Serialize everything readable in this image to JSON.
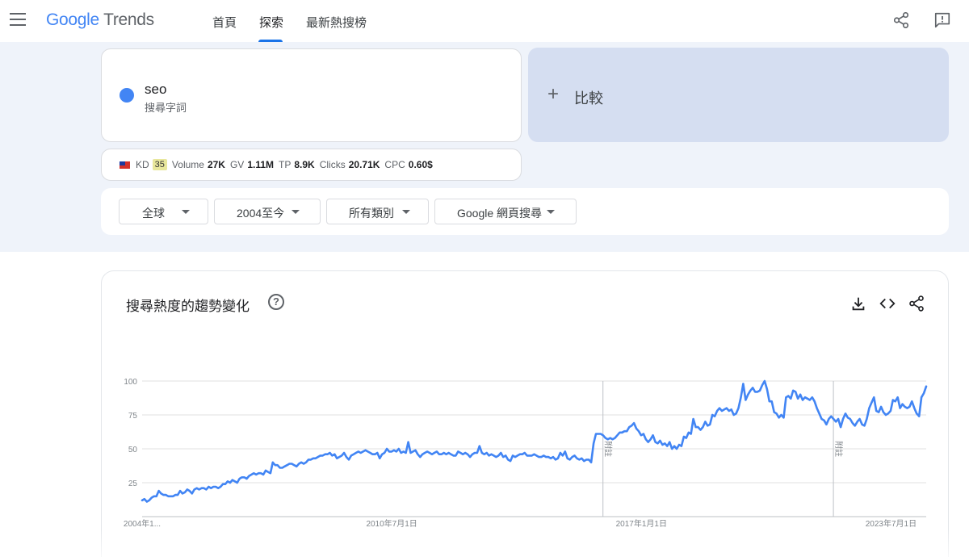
{
  "header": {
    "logo_google": "Google",
    "logo_product": "Trends",
    "tabs": [
      {
        "label": "首頁"
      },
      {
        "label": "探索"
      },
      {
        "label": "最新熱搜榜"
      }
    ],
    "active_tab": "探索"
  },
  "search_term": {
    "name": "seo",
    "type": "搜尋字詞",
    "color": "#4285f4"
  },
  "compare": {
    "label": "比較"
  },
  "metrics": {
    "kd_label": "KD",
    "kd_value": "35",
    "volume_label": "Volume",
    "volume_value": "27K",
    "gv_label": "GV",
    "gv_value": "1.11M",
    "tp_label": "TP",
    "tp_value": "8.9K",
    "clicks_label": "Clicks",
    "clicks_value": "20.71K",
    "cpc_label": "CPC",
    "cpc_value": "0.60$"
  },
  "filters": {
    "region": "全球",
    "time_range": "2004至今",
    "category": "所有類別",
    "search_type": "Google 網頁搜尋"
  },
  "chart_section": {
    "title": "搜尋熱度的趨勢變化",
    "help": "?"
  },
  "chart_data": {
    "type": "line",
    "series": [
      {
        "color": "#4285f4",
        "values": [
          12,
          13,
          11,
          12,
          14,
          15,
          15,
          19,
          17,
          16,
          16,
          15,
          15,
          15,
          16,
          16,
          19,
          17,
          18,
          20,
          19,
          17,
          20,
          21,
          20,
          21,
          21,
          20,
          22,
          21,
          22,
          22,
          21,
          22,
          24,
          24,
          26,
          25,
          27,
          26,
          25,
          28,
          29,
          29,
          28,
          30,
          31,
          32,
          31,
          32,
          32,
          31,
          34,
          33,
          32,
          40,
          38,
          38,
          36,
          36,
          37,
          38,
          39,
          39,
          38,
          37,
          39,
          40,
          39,
          40,
          42,
          42,
          43,
          43,
          44,
          45,
          45,
          46,
          46,
          47,
          45,
          46,
          43,
          44,
          45,
          47,
          44,
          42,
          45,
          46,
          47,
          48,
          47,
          48,
          49,
          48,
          47,
          46,
          46,
          47,
          43,
          46,
          47,
          50,
          48,
          48,
          49,
          48,
          50,
          47,
          48,
          47,
          55,
          47,
          48,
          49,
          46,
          44,
          46,
          47,
          48,
          47,
          46,
          47,
          48,
          46,
          46,
          47,
          46,
          47,
          46,
          45,
          45,
          48,
          47,
          46,
          47,
          46,
          44,
          46,
          47,
          47,
          52,
          47,
          46,
          47,
          45,
          46,
          45,
          44,
          45,
          47,
          44,
          45,
          42,
          41,
          45,
          44,
          45,
          46,
          46,
          47,
          45,
          45,
          45,
          46,
          45,
          44,
          44,
          45,
          44,
          44,
          43,
          44,
          42,
          43,
          47,
          45,
          48,
          43,
          42,
          44,
          45,
          43,
          42,
          43,
          41,
          42,
          42,
          40,
          54,
          61,
          61,
          61,
          60,
          58,
          57,
          58,
          57,
          58,
          60,
          62,
          62,
          63,
          63,
          66,
          67,
          69,
          65,
          63,
          60,
          61,
          57,
          55,
          57,
          60,
          55,
          54,
          56,
          53,
          54,
          52,
          55,
          50,
          52,
          50,
          53,
          52,
          59,
          58,
          62,
          61,
          72,
          66,
          66,
          64,
          66,
          70,
          67,
          68,
          75,
          74,
          78,
          80,
          78,
          79,
          80,
          78,
          79,
          75,
          76,
          80,
          88,
          98,
          86,
          90,
          93,
          95,
          92,
          92,
          93,
          97,
          100,
          94,
          85,
          85,
          77,
          76,
          73,
          75,
          73,
          88,
          89,
          87,
          93,
          92,
          87,
          90,
          86,
          88,
          87,
          86,
          88,
          85,
          80,
          76,
          72,
          71,
          68,
          72,
          74,
          72,
          70,
          72,
          66,
          72,
          76,
          73,
          72,
          69,
          67,
          70,
          72,
          68,
          67,
          72,
          80,
          84,
          88,
          78,
          77,
          81,
          77,
          75,
          76,
          78,
          86,
          85,
          88,
          80,
          83,
          81,
          80,
          81,
          85,
          80,
          76,
          74,
          88,
          91,
          96
        ]
      }
    ],
    "x_start": "2004-01",
    "x_end": "2024-06",
    "ylim": [
      0,
      100
    ],
    "y_ticks": [
      100,
      75,
      50,
      25
    ],
    "x_tick_labels": [
      "2004年1...",
      "2010年7月1日",
      "2017年1月1日",
      "2023年7月1日"
    ],
    "annotations": [
      {
        "label": "附註",
        "date": "2016-01"
      },
      {
        "label": "附註",
        "date": "2022-01"
      }
    ],
    "grid": true
  }
}
